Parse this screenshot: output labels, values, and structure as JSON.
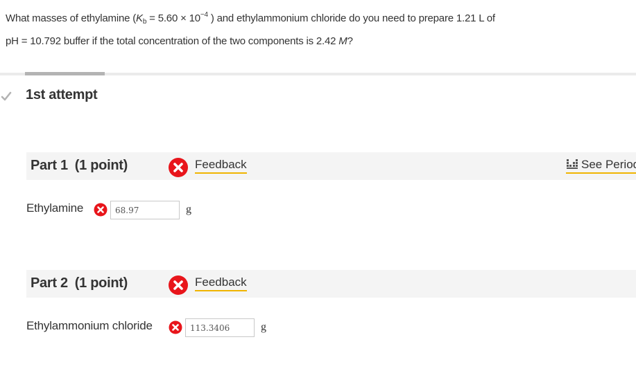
{
  "question": {
    "part_a": "What masses of ethylamine (",
    "kb_symbol": "K",
    "kb_sub": "b",
    "part_b": " = 5.60 ",
    "times": "×",
    "part_c": " 10",
    "exp": "−4",
    "part_d": " ) and ethylammonium chloride do you need to prepare 1.21 L of",
    "line2_a": "pH = 10.792 buffer if the total concentration of the two components is 2.42 ",
    "molar": "M",
    "line2_end": "?"
  },
  "attempt": {
    "title": "1st attempt"
  },
  "periodic_link": "See Period",
  "parts": [
    {
      "label": "Part 1",
      "points": "(1 point)",
      "feedback": "Feedback",
      "answer_label": "Ethylamine",
      "answer_value": "68.97",
      "unit": "g"
    },
    {
      "label": "Part 2",
      "points": "(1 point)",
      "feedback": "Feedback",
      "answer_label": "Ethylammonium chloride",
      "answer_value": "113.3406",
      "unit": "g"
    }
  ],
  "colors": {
    "error_red": "#e8151b",
    "feedback_underline": "#f0b400",
    "part_bar": "#f4f4f4",
    "divider": "#ebebeb",
    "divider_active": "#b3b3b3"
  },
  "icons": {
    "attempt_status": "checkmark-icon",
    "error": "x-circle-icon",
    "periodic_table": "periodic-table-icon"
  }
}
